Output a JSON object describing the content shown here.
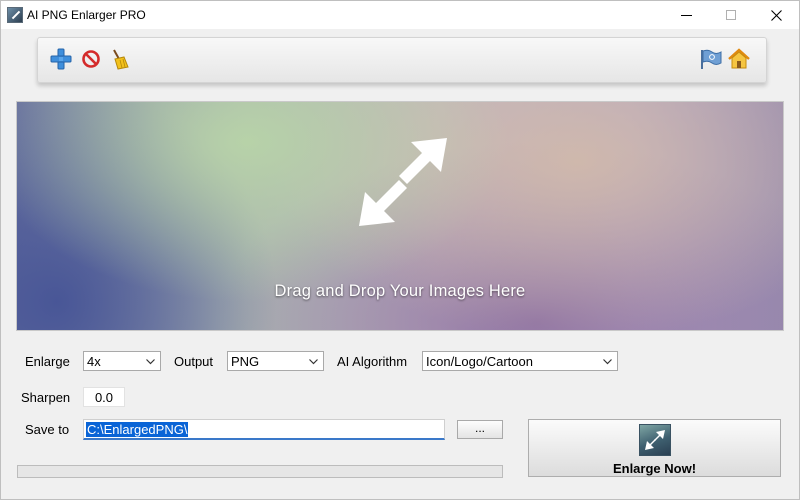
{
  "window": {
    "title": "AI PNG Enlarger PRO",
    "controls": [
      "minimize-icon",
      "maximize-icon",
      "close-icon"
    ]
  },
  "toolbar": {
    "left_icons": [
      "add-icon",
      "remove-icon",
      "clear-broom-icon"
    ],
    "right_icons": [
      "flag-icon",
      "home-icon"
    ]
  },
  "dropzone": {
    "text": "Drag and Drop Your Images Here",
    "icon": "resize-diagonal-arrow-icon"
  },
  "settings": {
    "enlarge": {
      "label": "Enlarge",
      "value": "4x"
    },
    "output": {
      "label": "Output",
      "value": "PNG"
    },
    "algorithm": {
      "label": "AI Algorithm",
      "value": "Icon/Logo/Cartoon"
    },
    "sharpen": {
      "label": "Sharpen",
      "value": "0.0"
    },
    "save_to": {
      "label": "Save to",
      "value": "C:\\EnlargedPNG\\"
    },
    "browse_label": "..."
  },
  "progress": {
    "value": 0
  },
  "action": {
    "enlarge_label": "Enlarge Now!",
    "icon": "enlarge-arrow-icon"
  },
  "colors": {
    "accent_blue": "#0a64d6",
    "progress_green": "#06b025"
  }
}
